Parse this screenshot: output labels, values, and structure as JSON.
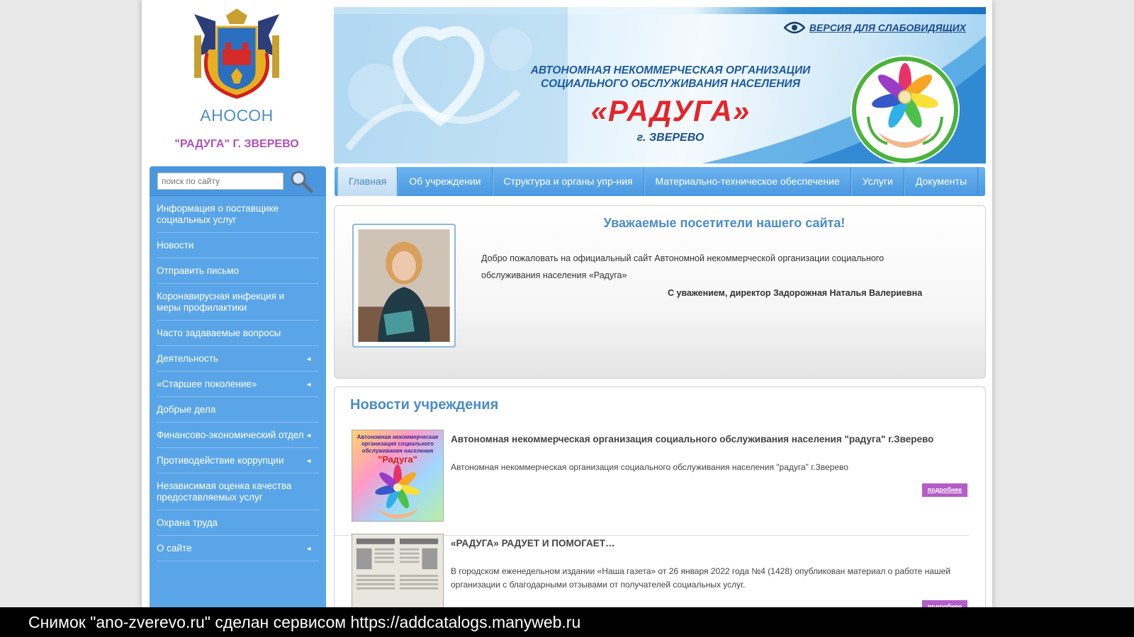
{
  "header": {
    "org_short": "АНОСОН",
    "org_city": "\"РАДУГА\" Г. ЗВЕРЕВО",
    "low_vision_link": "ВЕРСИЯ ДЛЯ СЛАБОВИДЯЩИХ",
    "banner_line1": "АВТОНОМНАЯ НЕКОММЕРЧЕСКАЯ ОРГАНИЗАЦИИ",
    "banner_line2": "СОЦИАЛЬНОГО ОБСЛУЖИВАНИЯ НАСЕЛЕНИЯ",
    "banner_name": "«РАДУГА»",
    "banner_city": "г. ЗВЕРЕВО"
  },
  "search": {
    "placeholder": "поиск по сайту"
  },
  "sidebar": {
    "items": [
      {
        "label": "Информация о поставщике социальных услуг",
        "arrow": ""
      },
      {
        "label": "Новости",
        "arrow": ""
      },
      {
        "label": "Отправить письмо",
        "arrow": ""
      },
      {
        "label": "Коронавирусная инфекция и меры профилактики",
        "arrow": ""
      },
      {
        "label": "Часто задаваемые вопросы",
        "arrow": ""
      },
      {
        "label": "Деятельность",
        "arrow": "◄"
      },
      {
        "label": "«Старшее поколение»",
        "arrow": "◄"
      },
      {
        "label": "Добрые дела",
        "arrow": ""
      },
      {
        "label": "Финансово-экономический отдел",
        "arrow": "◄"
      },
      {
        "label": "Противодействие коррупции",
        "arrow": "◄"
      },
      {
        "label": "Независимая оценка качества предоставляемых услуг",
        "arrow": ""
      },
      {
        "label": "Охрана труда",
        "arrow": ""
      },
      {
        "label": "О сайте",
        "arrow": "◄"
      }
    ]
  },
  "nav": {
    "tabs": [
      {
        "label": "Главная"
      },
      {
        "label": "Об учреждении"
      },
      {
        "label": "Структура и органы упр-ния"
      },
      {
        "label": "Материально-техническое обеспечение"
      },
      {
        "label": "Услуги"
      },
      {
        "label": "Документы"
      }
    ]
  },
  "welcome": {
    "title": "Уважаемые посетители нашего сайта!",
    "text": "Добро пожаловать на официальный сайт Автономной некоммерческой организации социального обслуживания населения «Радуга»",
    "signature": "С уважением, директор Задорожная Наталья Валериевна"
  },
  "news": {
    "heading": "Новости учреждения",
    "items": [
      {
        "title": "Автономная некоммерческая организация социального обслуживания населения \"радуга\" г.Зверево",
        "desc": "Автономная некоммерческая организация социального обслуживания населения \"радуга\" г.Зверево",
        "more": "подробнее",
        "thumb_line1": "Автономная некоммерческая",
        "thumb_line2": "организация социального",
        "thumb_line3": "обслуживания населения",
        "thumb_name": "\"Радуга\""
      },
      {
        "title": "«РАДУГА» РАДУЕТ И ПОМОГАЕТ…",
        "desc": "В городском еженедельном издании «Наша газета» от 26 января 2022 года №4 (1428) опубликован материал о работе нашей организации с благодарными отзывами от получателей социальных услуг.",
        "more": "подробнее"
      }
    ]
  },
  "caption": "Снимок \"ano-zverevo.ru\" сделан сервисом https://addcatalogs.manyweb.ru",
  "colors": {
    "sidebar": "#5aa5e8",
    "heading_blue": "#4b8cc8",
    "accent_purple": "#b45cc8",
    "banner_red": "#e3262c"
  }
}
